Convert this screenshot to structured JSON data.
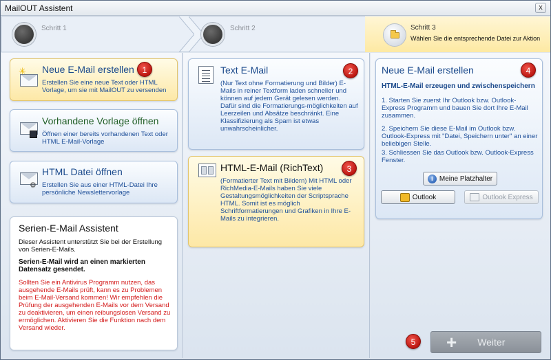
{
  "window": {
    "title": "MailOUT Assistent",
    "close_label": "x"
  },
  "steps": [
    {
      "label": "Schritt 1"
    },
    {
      "label": "Schritt 2"
    },
    {
      "label": "Schritt 3",
      "description": "Wählen Sie die entsprechende Datei zur Aktion"
    }
  ],
  "col1": {
    "cards": [
      {
        "title": "Neue E-Mail erstellen",
        "description": "Erstellen Sie eine neue Text oder HTML Vorlage, um sie mit MailOUT zu versenden",
        "badge": "1"
      },
      {
        "title": "Vorhandene Vorlage öffnen",
        "description": "Öffnen einer bereits vorhandenen Text oder HTML E-Mail-Vorlage"
      },
      {
        "title": "HTML Datei öffnen",
        "description": "Erstellen Sie aus einer HTML-Datei Ihre persönliche Newslettervorlage"
      }
    ],
    "info": {
      "title": "Serien-E-Mail Assistent",
      "text1": "Dieser Assistent unterstützt Sie bei der Erstellung von Serien-E-Mails.",
      "text2": "Serien-E-Mail wird an einen markierten Datensatz gesendet.",
      "warning": "Sollten Sie ein Antivirus Programm nutzen, das ausgehende E-Mails prüft, kann es zu Problemen beim E-Mail-Versand kommen! Wir empfehlen die Prüfung der ausgehenden E-Mails vor dem Versand zu deaktivieren, um einen reibungslosen Versand zu ermöglichen. Aktivieren Sie die Funktion nach dem Versand wieder."
    }
  },
  "col2": {
    "cards": [
      {
        "title": "Text E-Mail",
        "description": "(Nur Text ohne Formatierung und Bilder) E-Mails in reiner Textform laden schneller und können auf jedem Gerät gelesen werden. Dafür sind die Formatierungs-möglichkeiten auf Leerzeilen und Absätze beschränkt. Eine Klassifizierung als Spam ist etwas unwahrscheinlicher.",
        "badge": "2"
      },
      {
        "title": "HTML-E-Mail (RichText)",
        "description": "(Formatierter Text mit Bildern) Mit HTML oder RichMedia-E-Mails haben Sie viele Gestaltungsmöglichkeiten der Scriptsprache HTML. Somit ist es möglich Schriftformatierungen und Grafiken in Ihre E-Mails zu integrieren.",
        "badge": "3"
      }
    ]
  },
  "col3": {
    "title": "Neue E-Mail erstellen",
    "badge": "4",
    "subtitle": "HTML-E-Mail erzeugen und zwischenspeichern",
    "step1": "1. Starten Sie zuerst Ihr Outlook bzw. Outlook-Express Programm und bauen Sie dort Ihre E-Mail zusammen.",
    "step2": "2. Speichern Sie diese E-Mail im Outlook bzw. Outlook-Express mit \"Datei, Speichern unter\" an einer beliebigen Stelle.",
    "step3": "3. Schliessen Sie das Outlook bzw. Outlook-Express Fenster.",
    "placeholder_button": "Meine Platzhalter",
    "outlook_button": "Outlook",
    "outlook_express_button": "Outlook Express",
    "next_badge": "5",
    "next_button": "Weiter"
  }
}
